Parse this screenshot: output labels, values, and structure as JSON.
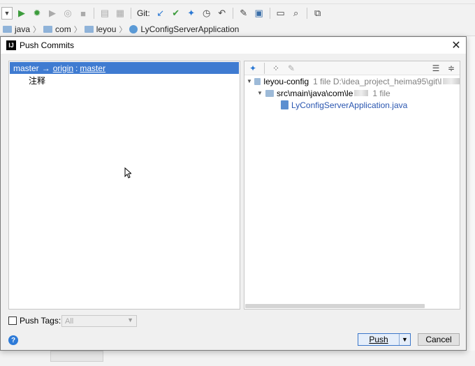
{
  "toolbar": {
    "git_label": "Git:",
    "icons": [
      "run-icon",
      "debug-icon",
      "coverage-icon",
      "profile-icon",
      "stop-icon",
      "build-icon",
      "update-project-icon",
      "commit-icon",
      "push-icon",
      "history-icon",
      "rollback-icon",
      "settings-icon",
      "project-structure-icon",
      "run-anything-icon",
      "search-icon",
      "sdk-icon"
    ]
  },
  "breadcrumb": {
    "items": [
      "java",
      "com",
      "leyou",
      "LyConfigServerApplication"
    ]
  },
  "dialog": {
    "title": "Push Commits",
    "branch": {
      "local": "master",
      "arrow": "→",
      "remote": "origin",
      "separator": ":",
      "remote_branch": "master"
    },
    "commits": [
      "注释"
    ],
    "tree": {
      "root_name": "leyou-config",
      "root_meta": "1 file  D:\\idea_project_heima95\\git\\l",
      "folder_name": "src\\main\\java\\com\\le",
      "folder_meta": "1 file",
      "file_name": "LyConfigServerApplication.java"
    },
    "push_tags_label": "Push Tags:",
    "tags_select_value": "All",
    "help_label": "?",
    "push_label": "Push",
    "cancel_label": "Cancel",
    "colors": {
      "selection": "#3f7bd1",
      "file_link": "#2a56b0"
    }
  }
}
